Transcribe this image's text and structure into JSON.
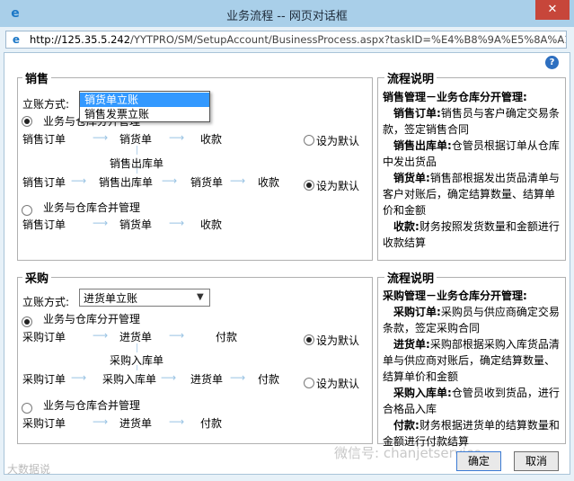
{
  "window": {
    "title": "业务流程 -- 网页对话框",
    "close_label": "✕"
  },
  "address": {
    "host": "http://125.35.5.242",
    "path": "/YYTPRO/SM/SetupAccount/BusinessProcess.aspx?taskID=%E4%B8%9A%E5%8A%A1%"
  },
  "help_label": "?",
  "sales": {
    "legend": "销售",
    "account_method_label": "立账方式:",
    "dropdown_options": [
      "销货单立账",
      "销售发票立账"
    ],
    "option1_label": "业务与仓库分开管理",
    "flow1_a": [
      "销售订单",
      "销货单",
      "收款"
    ],
    "flow1_mid": "销售出库单",
    "flow1_b": [
      "销售订单",
      "销售出库单",
      "销货单",
      "收款"
    ],
    "set_default_1": "设为默认",
    "set_default_2": "设为默认",
    "option2_label": "业务与仓库合并管理",
    "flow2": [
      "销售订单",
      "销货单",
      "收款"
    ]
  },
  "sales_desc": {
    "legend": "流程说明",
    "heading": "销售管理－业务仓库分开管理:",
    "items": [
      {
        "term": "销售订单:",
        "text": "销售员与客户确定交易条款，签定销售合同"
      },
      {
        "term": "销售出库单:",
        "text": "仓管员根据订单从仓库中发出货品"
      },
      {
        "term": "销货单:",
        "text": "销售部根据发出货品清单与客户对账后，确定结算数量、结算单价和金额"
      },
      {
        "term": "收款:",
        "text": "财务按照发货数量和金额进行收款结算"
      }
    ]
  },
  "purchase": {
    "legend": "采购",
    "account_method_label": "立账方式:",
    "select_value": "进货单立账",
    "option1_label": "业务与仓库分开管理",
    "flow1_a": [
      "采购订单",
      "进货单",
      "付款"
    ],
    "flow1_mid": "采购入库单",
    "flow1_b": [
      "采购订单",
      "采购入库单",
      "进货单",
      "付款"
    ],
    "set_default_1": "设为默认",
    "set_default_2": "设为默认",
    "option2_label": "业务与仓库合并管理",
    "flow2": [
      "采购订单",
      "进货单",
      "付款"
    ]
  },
  "purchase_desc": {
    "legend": "流程说明",
    "heading": "采购管理－业务仓库分开管理:",
    "items": [
      {
        "term": "采购订单:",
        "text": "采购员与供应商确定交易条款，签定采购合同"
      },
      {
        "term": "进货单:",
        "text": "采购部根据采购入库货品清单与供应商对账后，确定结算数量、结算单价和金额"
      },
      {
        "term": "采购入库单:",
        "text": "仓管员收到货品，进行合格品入库"
      },
      {
        "term": "付款:",
        "text": "财务根据进货单的结算数量和金额进行付款结算"
      }
    ]
  },
  "buttons": {
    "ok": "确定",
    "cancel": "取消"
  },
  "watermarks": {
    "wechat": "微信号: chanjetservice",
    "corner": "大数据说"
  }
}
